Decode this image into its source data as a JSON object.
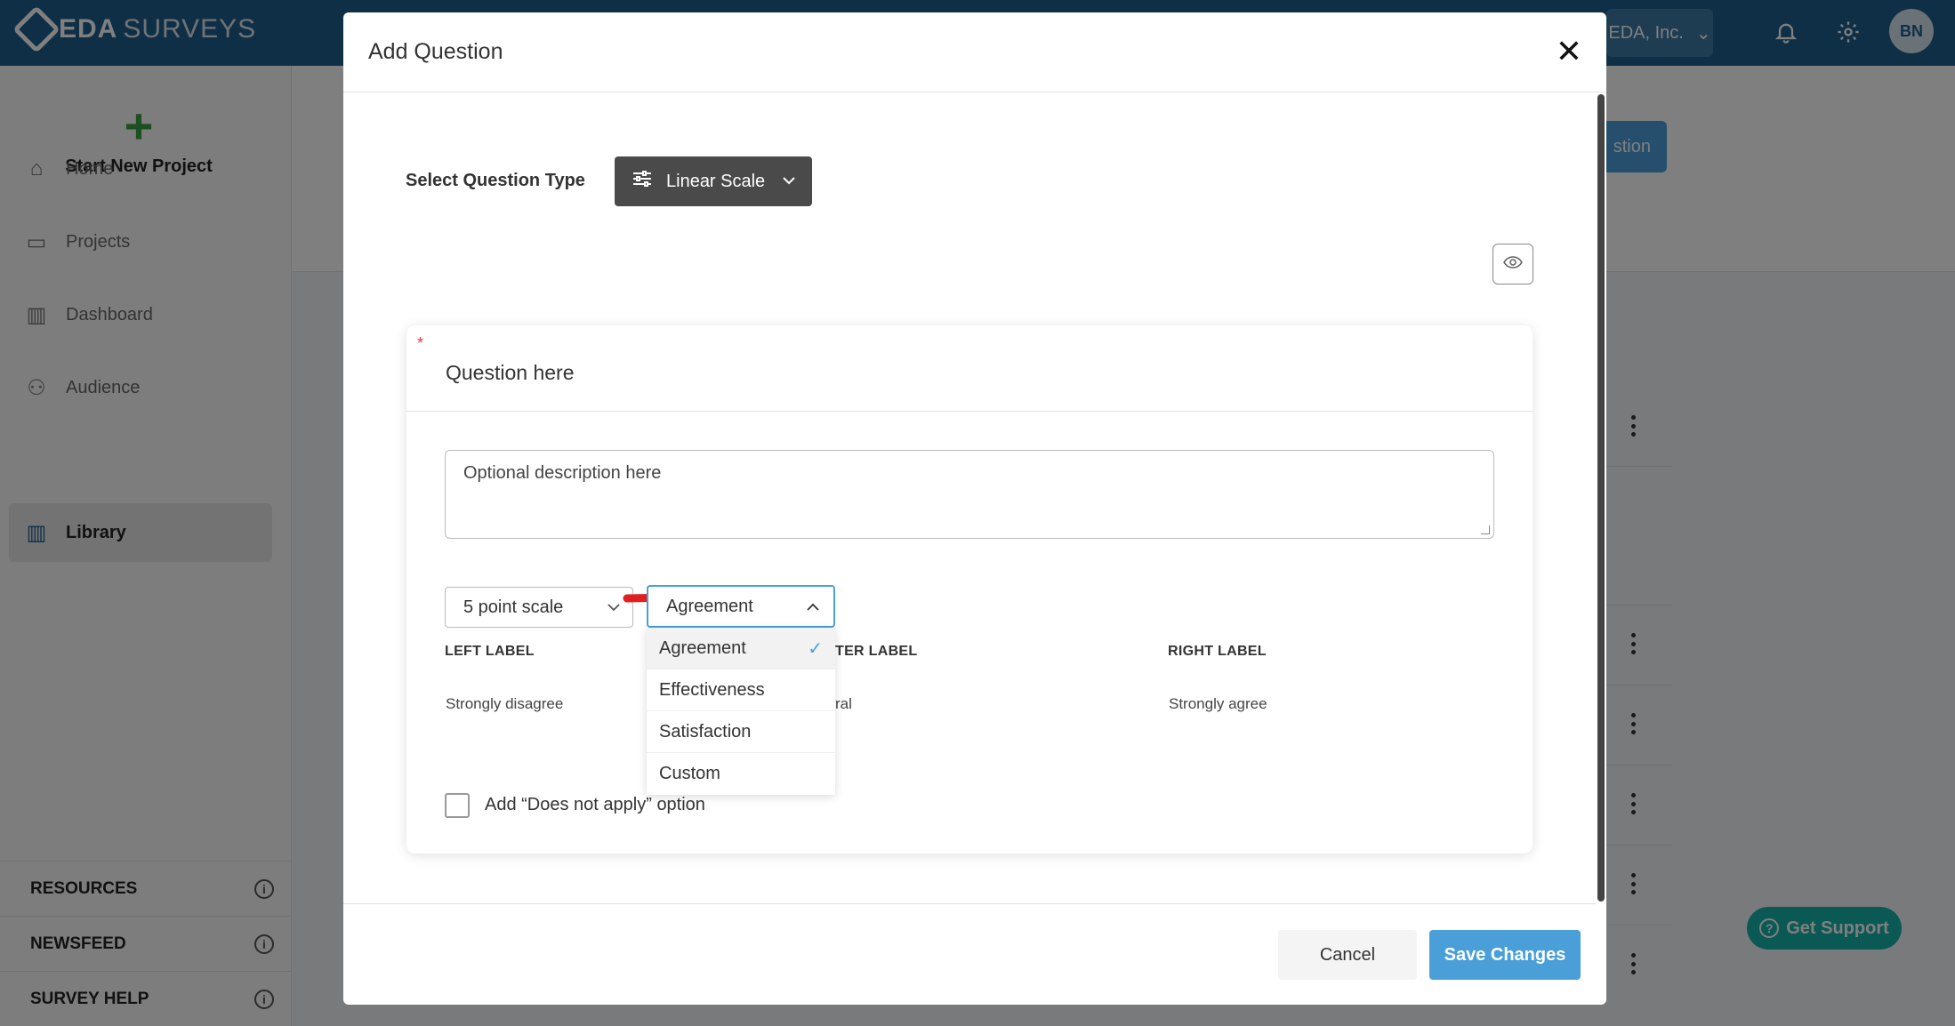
{
  "app": {
    "brand_main": "EDA",
    "brand_rest": "SURVEYS",
    "org_selector": "EDA, Inc.",
    "avatar_initials": "BN",
    "accent_color": "#1e5f8c"
  },
  "sidebar": {
    "start_project": "Start New Project",
    "items": [
      {
        "label": "Home",
        "icon": "home-icon"
      },
      {
        "label": "Projects",
        "icon": "folder-icon"
      },
      {
        "label": "Dashboard",
        "icon": "bar-chart-icon"
      },
      {
        "label": "Audience",
        "icon": "people-icon"
      },
      {
        "label": "Library",
        "icon": "library-icon",
        "active": true
      }
    ],
    "sections": [
      "RESOURCES",
      "NEWSFEED",
      "SURVEY HELP"
    ]
  },
  "background": {
    "add_question_button_partial": "stion"
  },
  "support": {
    "label": "Get Support"
  },
  "modal": {
    "title": "Add Question",
    "question_type_label": "Select Question Type",
    "question_type_value": "Linear Scale",
    "question_placeholder": "Question here",
    "description_placeholder": "Optional description here",
    "scale_value": "5 point scale",
    "preset_value": "Agreement",
    "preset_options": [
      {
        "label": "Agreement",
        "selected": true
      },
      {
        "label": "Effectiveness",
        "selected": false
      },
      {
        "label": "Satisfaction",
        "selected": false
      },
      {
        "label": "Custom",
        "selected": false
      }
    ],
    "left_label_header": "LEFT LABEL",
    "center_label_header_partial": "TER LABEL",
    "right_label_header": "RIGHT LABEL",
    "left_label_value": "Strongly disagree",
    "center_label_value_partial": "ral",
    "right_label_value": "Strongly agree",
    "does_not_apply_label": "Add “Does not apply” option",
    "cancel_label": "Cancel",
    "save_label": "Save Changes"
  }
}
